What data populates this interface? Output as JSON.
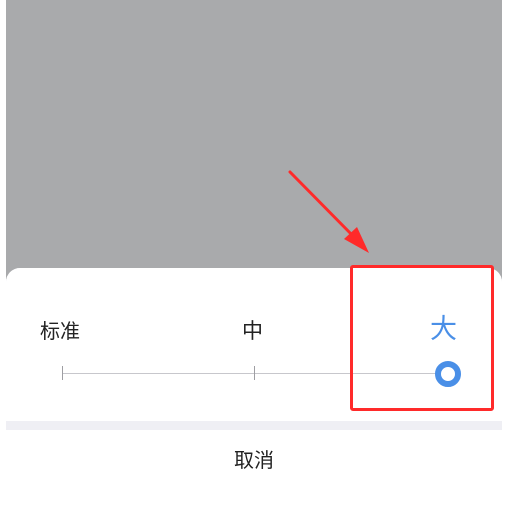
{
  "font_size_options": [
    {
      "label": "标准"
    },
    {
      "label": "中"
    },
    {
      "label": "大",
      "selected": true
    }
  ],
  "slider": {
    "selected_index": 2,
    "max_index": 2
  },
  "cancel_label": "取消",
  "colors": {
    "overlay": "#a9aaac",
    "accent": "#4a8fe7",
    "annotation": "#ff2a2a"
  }
}
